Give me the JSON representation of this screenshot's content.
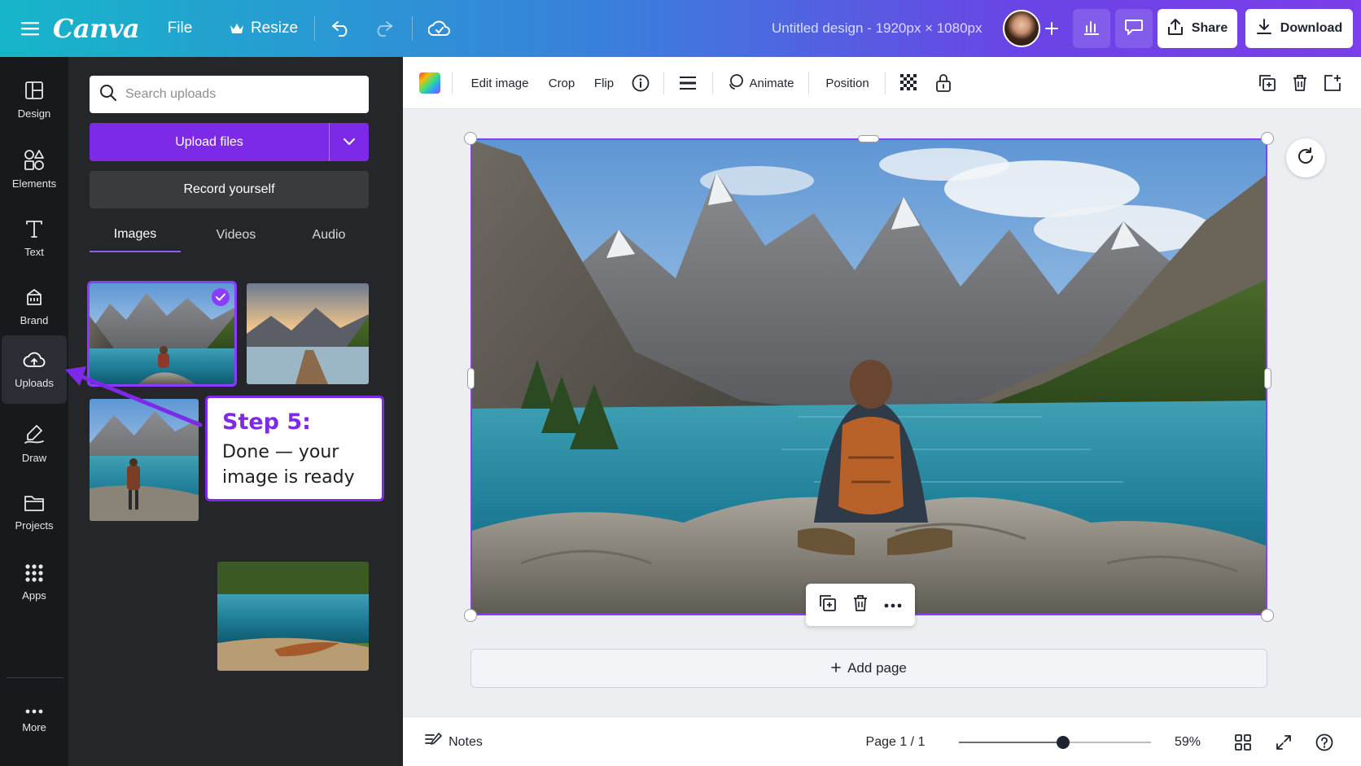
{
  "topbar": {
    "logo": "Canva",
    "file_label": "File",
    "resize_label": "Resize",
    "doc_title": "Untitled design - 1920px × 1080px",
    "share_label": "Share",
    "download_label": "Download"
  },
  "rail": {
    "items": [
      {
        "label": "Design"
      },
      {
        "label": "Elements"
      },
      {
        "label": "Text"
      },
      {
        "label": "Brand"
      },
      {
        "label": "Uploads"
      },
      {
        "label": "Draw"
      },
      {
        "label": "Projects"
      },
      {
        "label": "Apps"
      },
      {
        "label": "More"
      }
    ],
    "active": "Uploads"
  },
  "panel": {
    "search_placeholder": "Search uploads",
    "upload_label": "Upload files",
    "record_label": "Record yourself",
    "tabs": [
      {
        "label": "Images"
      },
      {
        "label": "Videos"
      },
      {
        "label": "Audio"
      }
    ],
    "active_tab": "Images"
  },
  "callout": {
    "title": "Step 5:",
    "body_line1": "Done — your",
    "body_line2": "image is ready"
  },
  "context_toolbar": {
    "edit_image_label": "Edit image",
    "crop_label": "Crop",
    "flip_label": "Flip",
    "animate_label": "Animate",
    "position_label": "Position"
  },
  "canvas": {
    "add_page_label": "Add page"
  },
  "bottombar": {
    "notes_label": "Notes",
    "page_indicator": "Page 1 / 1",
    "zoom_label": "59%",
    "zoom_level": 0.59
  },
  "colors": {
    "accent": "#7d2ae8",
    "selection": "#8b3dff"
  }
}
